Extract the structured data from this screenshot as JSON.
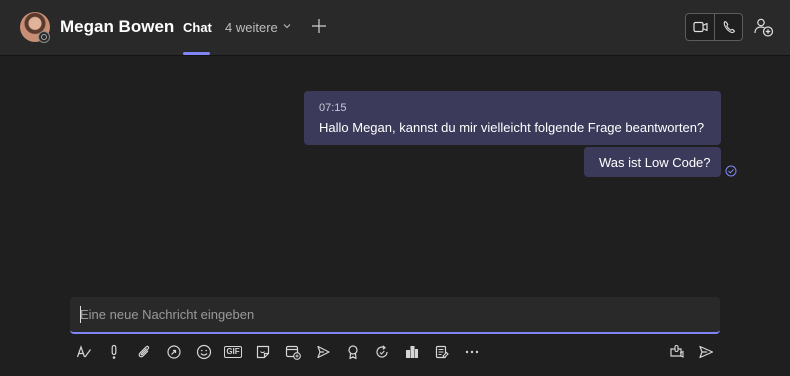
{
  "header": {
    "contact_name": "Megan Bowen",
    "tab_chat": "Chat",
    "more_tabs": "4 weitere"
  },
  "messages": [
    {
      "time": "07:15",
      "text": "Hallo Megan, kannst du mir vielleicht folgende Frage beantworten?"
    },
    {
      "text": "Was ist Low Code?"
    }
  ],
  "compose": {
    "placeholder": "Eine neue Nachricht eingeben",
    "gif_label": "GIF"
  },
  "colors": {
    "accent": "#7f85f5",
    "bubble": "#3b3a5a",
    "background": "#1f1f1f",
    "header": "#292929"
  },
  "toolbar_icons": [
    "format-icon",
    "important-icon",
    "attach-icon",
    "loop-icon",
    "emoji-icon",
    "gif-icon",
    "sticker-icon",
    "schedule-meeting-icon",
    "stream-icon",
    "praise-icon",
    "updates-icon",
    "approvals-icon",
    "tasks-icon",
    "more-options-icon",
    "audio-message-icon",
    "send-icon"
  ]
}
